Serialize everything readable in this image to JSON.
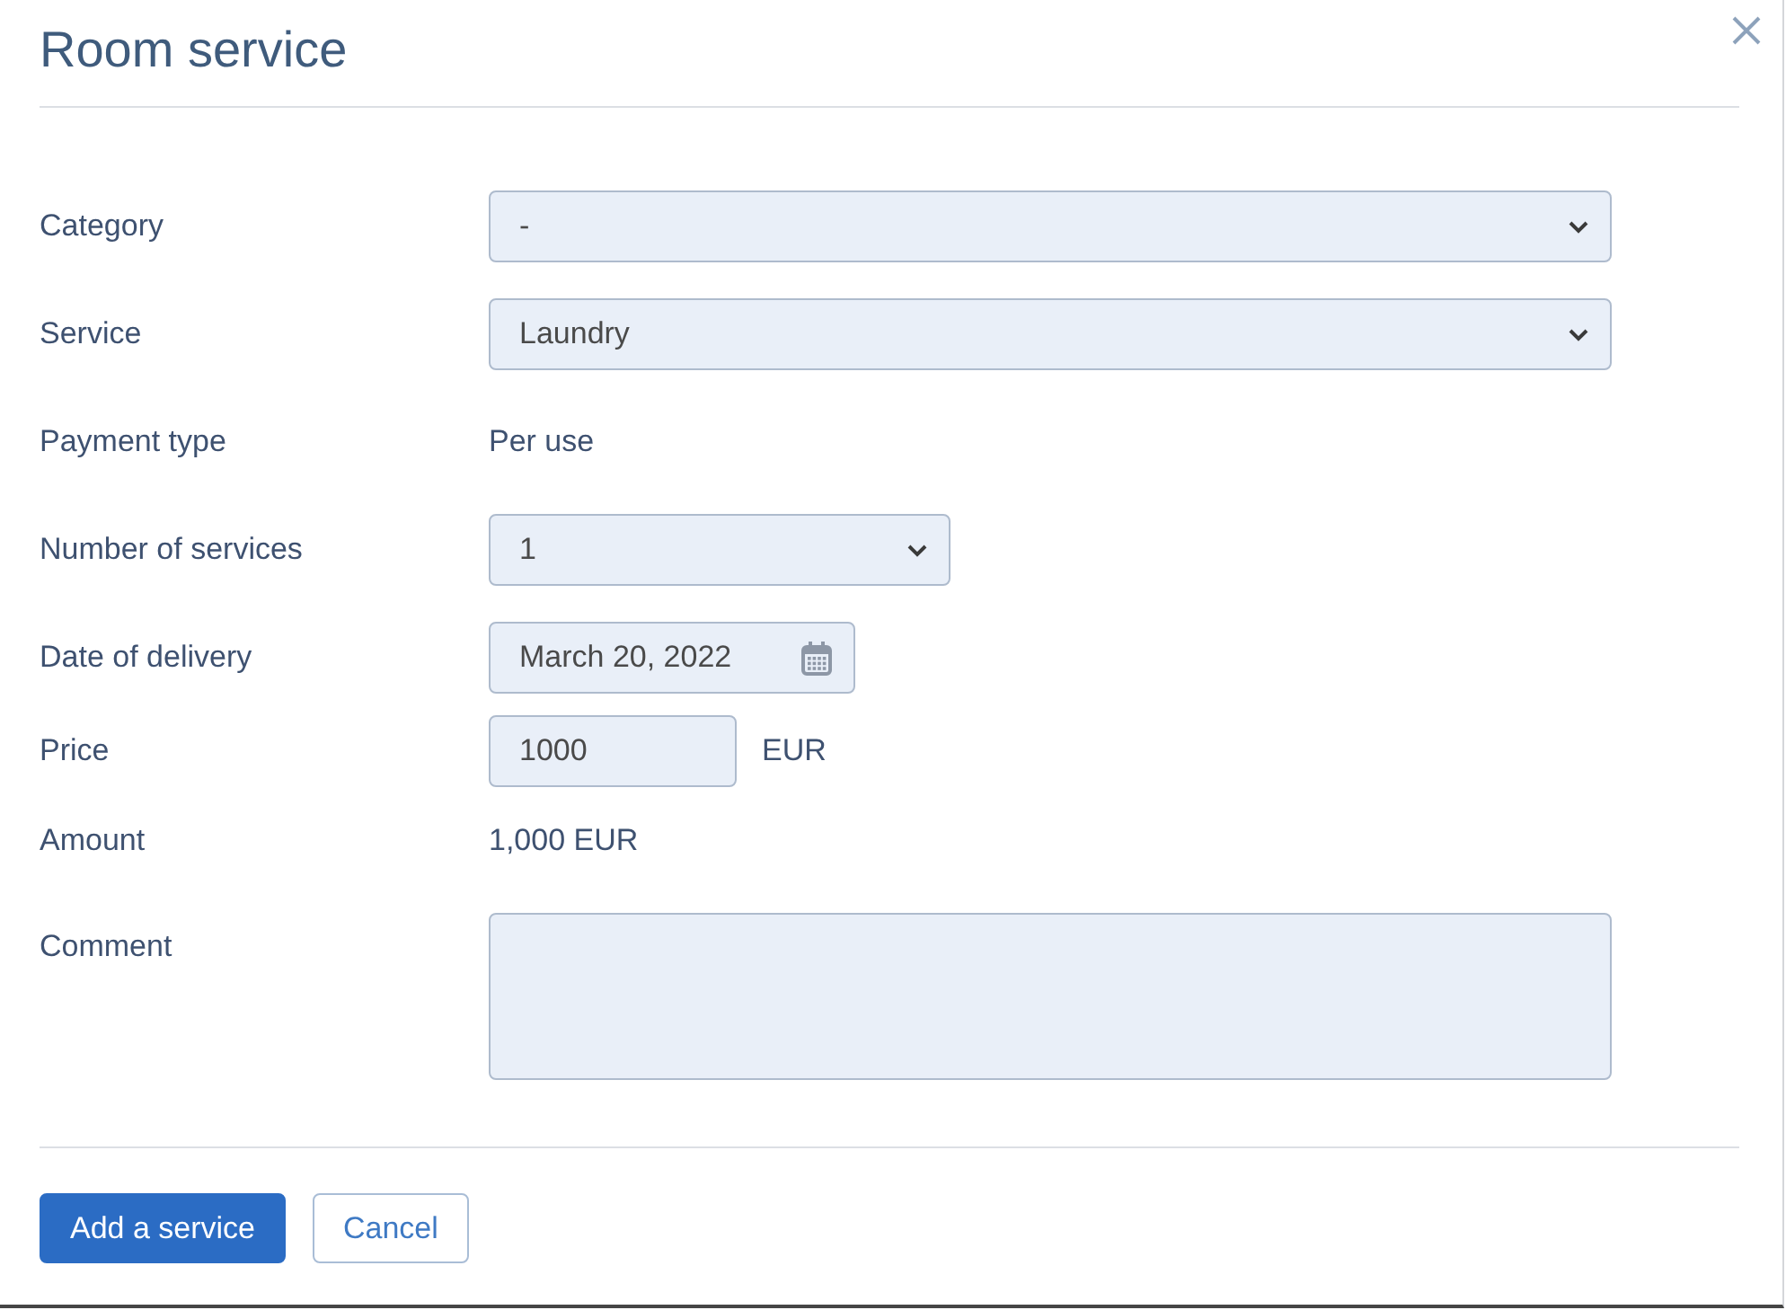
{
  "dialog": {
    "title": "Room service"
  },
  "fields": [
    {
      "kind": "select",
      "label": "Category",
      "value": "-"
    },
    {
      "kind": "select",
      "label": "Service",
      "value": "Laundry"
    },
    {
      "kind": "static",
      "label": "Payment type",
      "value": "Per use"
    },
    {
      "kind": "counter",
      "label": "Number of services",
      "value": "1"
    },
    {
      "kind": "date",
      "label": "Date of delivery",
      "value": "March 20, 2022"
    },
    {
      "kind": "price",
      "label": "Price",
      "value": "1000",
      "unit": "EUR"
    },
    {
      "kind": "static",
      "label": "Amount",
      "value": "1,000 EUR"
    },
    {
      "kind": "textarea",
      "label": "Comment"
    }
  ],
  "buttons": [
    {
      "kind": "primary",
      "label": "Add a service"
    },
    {
      "kind": "secondary",
      "label": "Cancel"
    }
  ]
}
